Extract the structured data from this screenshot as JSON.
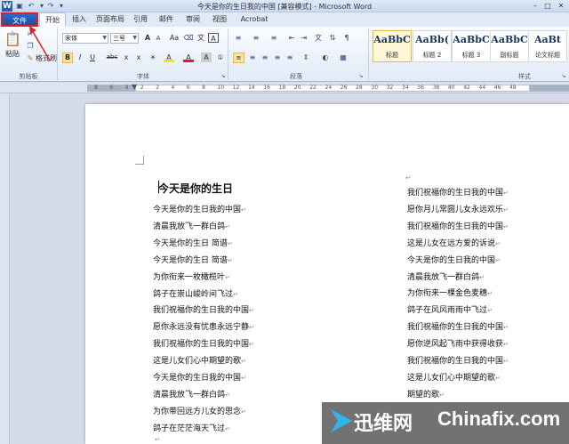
{
  "window": {
    "title": "今天是你的生日我的中国 [兼容模式] - Microsoft Word",
    "app_icon_letter": "W"
  },
  "tabs": {
    "file": "文件",
    "items": [
      "开始",
      "插入",
      "页面布局",
      "引用",
      "邮件",
      "审阅",
      "视图",
      "Acrobat"
    ],
    "active_index": 0
  },
  "ribbon": {
    "clipboard": {
      "paste_label": "粘贴",
      "format_painter_label": "格式刷",
      "group_label": "剪贴板"
    },
    "font": {
      "font_name": "宋体",
      "font_size": "三号",
      "group_label": "字体",
      "grow_font": "A",
      "shrink_font": "A",
      "change_case": "Aa",
      "bold": "B",
      "italic": "I",
      "underline": "U",
      "strikethrough": "abc",
      "subscript": "x",
      "superscript": "x",
      "font_color_letter": "A",
      "highlight_letter": "A"
    },
    "paragraph": {
      "group_label": "段落"
    },
    "styles": {
      "group_label": "样式",
      "items": [
        {
          "sample": "AaBbC",
          "name": "标题"
        },
        {
          "sample": "AaBb(",
          "name": "标题 2"
        },
        {
          "sample": "AaBbC",
          "name": "标题 3"
        },
        {
          "sample": "AaBbC",
          "name": "副标题"
        },
        {
          "sample": "AaBt",
          "name": "论文标题"
        }
      ]
    }
  },
  "ruler": {
    "numbers": [
      "8",
      "6",
      "4",
      "2",
      "2",
      "4",
      "6",
      "8",
      "10",
      "12",
      "14",
      "16",
      "18",
      "20",
      "22",
      "24",
      "26",
      "28",
      "30",
      "32",
      "34",
      "36",
      "38",
      "40",
      "42",
      "44",
      "46",
      "48"
    ]
  },
  "document": {
    "title": "今天是你的生日",
    "left_column": [
      "今天是你的生日我的中国",
      "清晨我放飞一群白鸽",
      "今天是你的生日  简谱",
      "今天是你的生日  简谱",
      "为你衔来一枚橄榄叶",
      "鸽子在崇山峻岭间飞过",
      "我们祝福你的生日我的中国",
      "愿你永远没有忧患永远宁静",
      "我们祝福你的生日我的中国",
      "这是儿女们心中期望的歌",
      "今天是你的生日我的中国",
      "清晨我放飞一群白鸽",
      "为你带回远方儿女的思念",
      "鸽子在茫茫海天飞过"
    ],
    "right_column": [
      "我们祝福你的生日我的中国",
      "愿你月儿常圆儿女永远欢乐",
      "我们祝福你的生日我的中国",
      "这是儿女在远方爱的诉说",
      "今天是你的生日我的中国",
      "清晨我放飞一群白鸽",
      "为你衔来一棵金色麦穗",
      "鸽子在风风雨雨中飞过",
      "我们祝福你的生日我的中国",
      "愿你逆风起飞雨中获得收获",
      "我们祝福你的生日我的中国",
      "这是儿女们心中期望的歌",
      "期望的歌"
    ],
    "paragraph_mark": "↵"
  },
  "watermark": {
    "cn_text": "迅维网",
    "en_text": "Chinafix.com"
  },
  "colors": {
    "file_tab": "#2e6bc6",
    "highlight_box": "#e02020",
    "ribbon_active": "#fde59c"
  }
}
